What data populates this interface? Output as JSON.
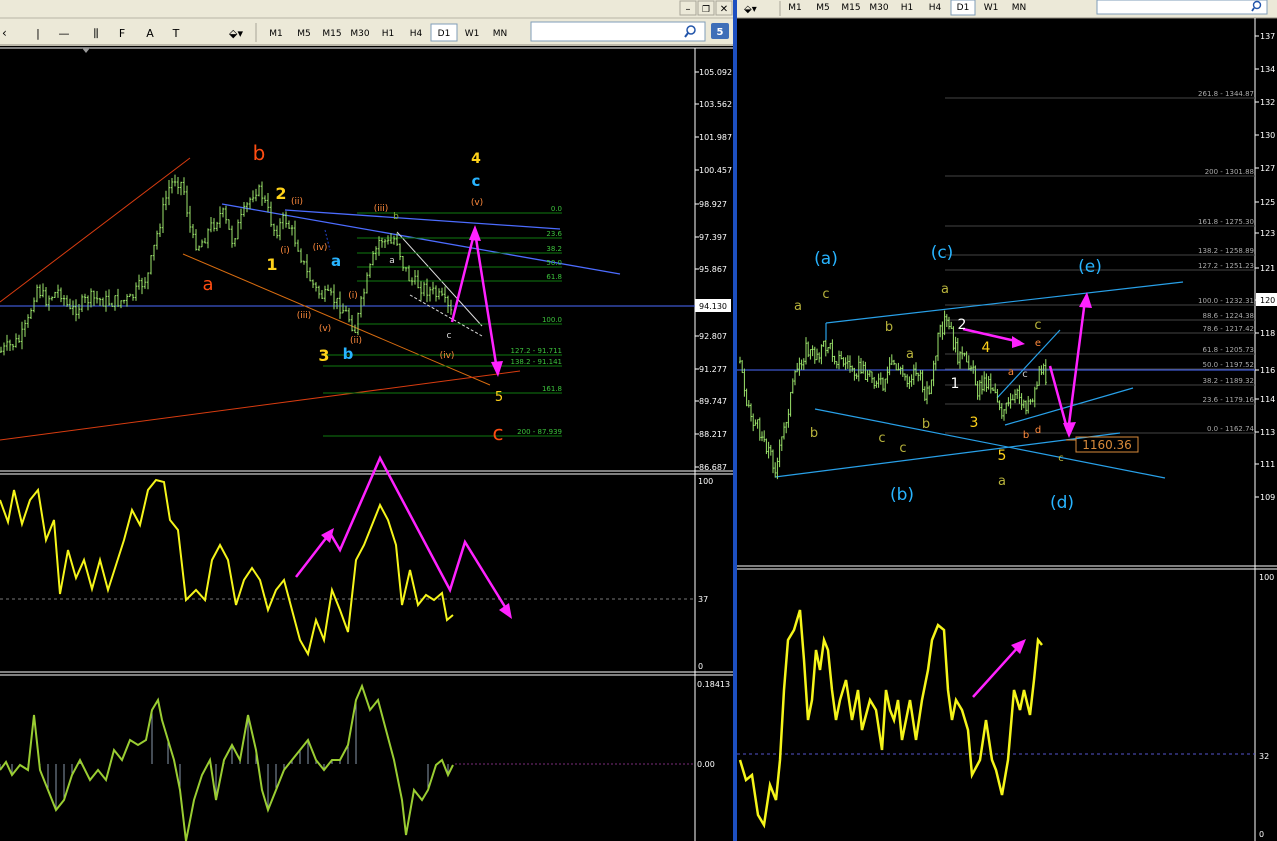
{
  "toolbar": {
    "timeframes": [
      "M1",
      "M5",
      "M15",
      "M30",
      "H1",
      "H4",
      "D1",
      "W1",
      "MN"
    ],
    "active_timeframe": "D1",
    "draw_tools": [
      "|",
      "—",
      "⫼",
      "F",
      "A",
      "T"
    ],
    "badge": "5"
  },
  "left_chart": {
    "price_axis": [
      "105.092",
      "103.562",
      "101.987",
      "100.457",
      "98.927",
      "97.397",
      "95.867",
      "94.130",
      "92.807",
      "91.277",
      "89.747",
      "88.217",
      "86.687"
    ],
    "current_price": "94.130",
    "wave_labels": {
      "big": [
        {
          "t": "b",
          "c": "#ff4d12"
        },
        {
          "t": "a",
          "c": "#ff4d12"
        },
        {
          "t": "c",
          "c": "#ff4d12"
        }
      ],
      "yellow": [
        {
          "t": "2",
          "c": "#ffd21a"
        },
        {
          "t": "1",
          "c": "#ffd21a"
        },
        {
          "t": "3",
          "c": "#ffd21a"
        },
        {
          "t": "4",
          "c": "#ffd21a"
        },
        {
          "t": "5",
          "c": "#ffd21a"
        }
      ],
      "blue": [
        {
          "t": "a",
          "c": "#28b4ff"
        },
        {
          "t": "b",
          "c": "#28b4ff"
        },
        {
          "t": "c",
          "c": "#28b4ff"
        }
      ],
      "small": [
        {
          "t": "(ii)"
        },
        {
          "t": "(i)"
        },
        {
          "t": "(iv)"
        },
        {
          "t": "(iii)"
        },
        {
          "t": "(v)"
        },
        {
          "t": "(i)"
        },
        {
          "t": "(ii)"
        },
        {
          "t": "(iii)"
        },
        {
          "t": "(iv)"
        },
        {
          "t": "(v)"
        },
        {
          "t": "a"
        },
        {
          "t": "b"
        },
        {
          "t": "c"
        }
      ]
    },
    "fib_levels": [
      {
        "label": "0.0"
      },
      {
        "label": "23.6"
      },
      {
        "label": "38.2"
      },
      {
        "label": "50.0"
      },
      {
        "label": "61.8"
      },
      {
        "label": "100.0"
      },
      {
        "label": "127.2 - 91.711"
      },
      {
        "label": "138.2 - 91.141"
      },
      {
        "label": "161.8"
      },
      {
        "label": "200 - 87.939"
      }
    ],
    "rsi_axis": [
      "100",
      "37",
      "0"
    ],
    "osc_axis": [
      "0.18413",
      "0.00"
    ]
  },
  "right_chart": {
    "price_axis": [
      "137",
      "134",
      "132",
      "130",
      "127",
      "125",
      "123",
      "121",
      "120",
      "118",
      "116",
      "114",
      "113",
      "111",
      "109"
    ],
    "current_price": "120",
    "fib_levels": [
      {
        "label": "261.8 - 1344.87"
      },
      {
        "label": "200 - 1301.88"
      },
      {
        "label": "161.8 - 1275.30"
      },
      {
        "label": "138.2 - 1258.89"
      },
      {
        "label": "127.2 - 1251.23"
      },
      {
        "label": "100.0 - 1232.31"
      },
      {
        "label": "88.6 - 1224.38"
      },
      {
        "label": "78.6 - 1217.42"
      },
      {
        "label": "61.8 - 1205.73"
      },
      {
        "label": "50.0 - 1197.52"
      },
      {
        "label": "38.2 - 1189.32"
      },
      {
        "label": "23.6 - 1179.16"
      },
      {
        "label": "0.0 - 1162.74"
      }
    ],
    "price_box": "1160.36",
    "wave_labels": {
      "blue": [
        "(a)",
        "(c)",
        "(e)",
        "(b)",
        "(d)"
      ],
      "olive": [
        "a",
        "c",
        "b",
        "a",
        "b",
        "c",
        "c",
        "a",
        "b",
        "c",
        "a"
      ],
      "white": [
        "2",
        "4",
        "1",
        "3",
        "5"
      ],
      "small": [
        "e",
        "a",
        "c",
        "b",
        "d",
        "c"
      ]
    },
    "rsi_axis": [
      "100",
      "32",
      "0"
    ]
  },
  "colors": {
    "background": "#000000",
    "price": "#9be36b",
    "rsi": "#f5f51a",
    "arrow": "#ff22ff",
    "fib": "#0f7a0f",
    "wave_red": "#ff4d12",
    "wave_blue": "#28b4ff",
    "wave_yellow": "#ffd21a",
    "channel_blue": "#4c6cff",
    "toolbar": "#ece9d8"
  }
}
